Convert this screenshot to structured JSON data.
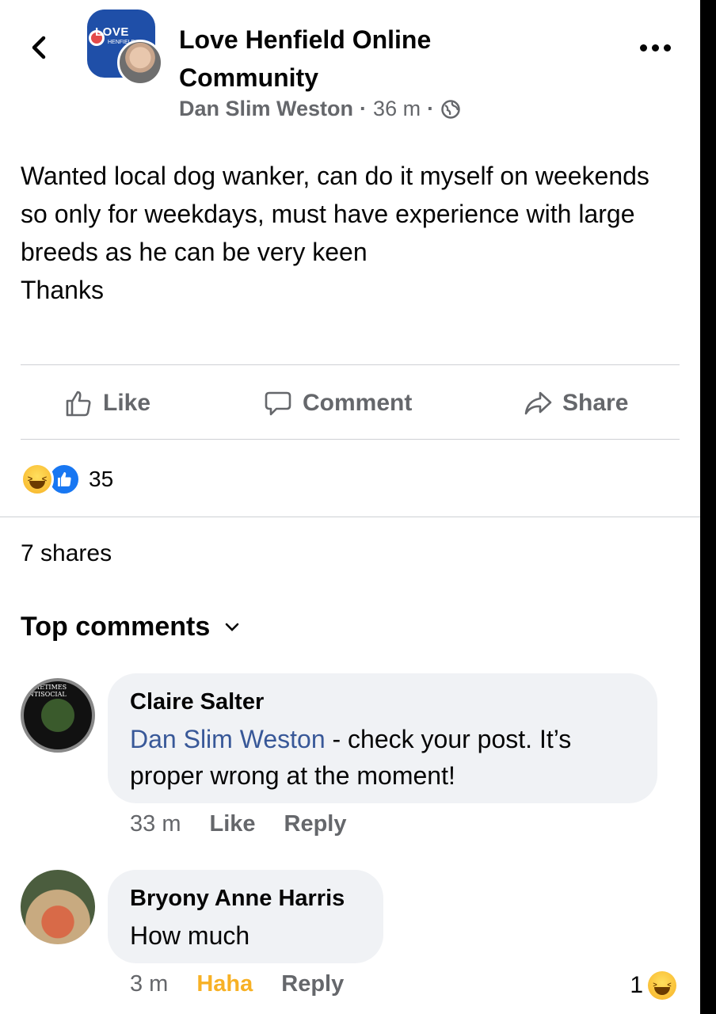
{
  "header": {
    "back_icon": "chevron-left-icon",
    "group_logo_text": "LOVE",
    "group_logo_sub": "HENFIELD",
    "group_name": "Love Henfield Online Community",
    "author": "Dan Slim Weston",
    "time": "36 m",
    "separator": "·",
    "privacy_icon": "globe-icon",
    "more_icon": "more-horizontal-icon"
  },
  "post": {
    "text": "Wanted local dog wanker, can do it myself on weekends so only for weekdays, must have experience with large breeds as he can be very keen\nThanks"
  },
  "actions": {
    "like": "Like",
    "comment": "Comment",
    "share": "Share"
  },
  "reactions": {
    "count": "35",
    "types": [
      "haha",
      "like"
    ]
  },
  "shares": "7 shares",
  "comments_header": {
    "label": "Top comments"
  },
  "comments": [
    {
      "name": "Claire Salter",
      "mention": "Dan Slim Weston",
      "text": " - check your post. It’s proper wrong at the moment!",
      "time": "33 m",
      "like_label": "Like",
      "reply_label": "Reply",
      "avatar_text": "SOMETIMES ANTISOCIAL · ALWAYS ANTIFASCIST"
    },
    {
      "name": "Bryony Anne Harris",
      "text": "How much",
      "time": "3 m",
      "reaction_label": "Haha",
      "reply_label": "Reply",
      "reaction_count": "1"
    }
  ],
  "colors": {
    "link": "#385898",
    "secondary_text": "#65676b",
    "bubble": "#f0f2f5",
    "haha": "#f7b125",
    "like_blue": "#1877f2"
  }
}
